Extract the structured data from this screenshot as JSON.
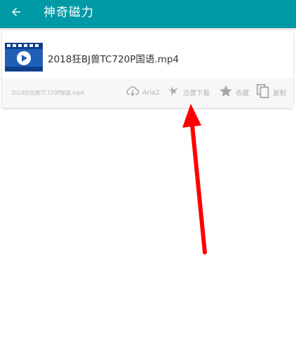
{
  "appbar": {
    "title": "神奇磁力",
    "back_icon": "arrow-left-icon",
    "background": "#009aa6"
  },
  "result": {
    "thumbnail_icon": "video-file-icon",
    "title": "2018狂BJ兽TC720P国语.mp4",
    "file_name": "2018狂BJ兽TC720P国语.mp4",
    "actions": [
      {
        "label": "Aria2",
        "icon": "cloud-download-icon"
      },
      {
        "label": "迅雷下载",
        "icon": "thunder-bird-icon"
      },
      {
        "label": "收藏",
        "icon": "star-icon"
      },
      {
        "label": "复制",
        "icon": "copy-icon"
      }
    ]
  },
  "annotation": {
    "icon": "red-arrow-icon",
    "color": "#ff0000"
  }
}
